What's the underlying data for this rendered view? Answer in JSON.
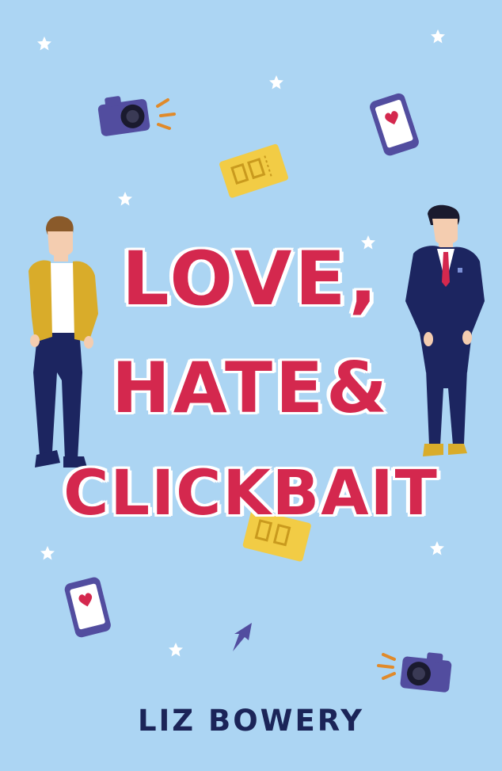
{
  "cover": {
    "title_line1": "LOVE,",
    "title_line2": "HATE&",
    "title_line3": "CLICKBAIT",
    "author": "LIZ BOWERY"
  },
  "colors": {
    "background": "#acd5f3",
    "title": "#d4284e",
    "author": "#1b2458",
    "suit": "#1c2560",
    "jacket": "#d9ac2a",
    "ticket": "#f2cc45",
    "camera": "#524d9f"
  },
  "icons": [
    "camera-icon",
    "phone-heart-icon",
    "ticket-icon",
    "star-icon",
    "cursor-arrow-icon"
  ]
}
